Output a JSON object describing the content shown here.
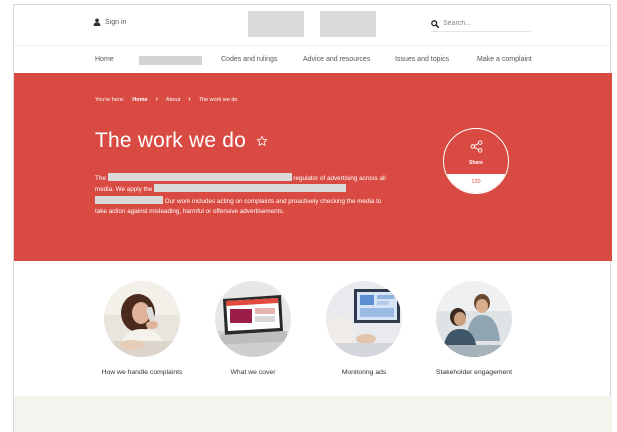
{
  "header": {
    "sign_in_label": "Sign in",
    "search_placeholder": "Search..."
  },
  "nav": {
    "items": [
      "Home",
      "Codes and rulings",
      "Advice and resources",
      "Issues and topics",
      "Make a complaint"
    ]
  },
  "hero": {
    "breadcrumb_prefix": "You're here:",
    "breadcrumb": [
      "Home",
      "About",
      "The work we do"
    ],
    "title": "The work we do",
    "text_1": "The",
    "text_2": "regulator of advertising across all media. We apply the",
    "text_3": "Our work includes acting on complaints and proactively checking the media to take action against misleading, harmful or offensive advertisements.",
    "share_label": "Share",
    "share_count": "120"
  },
  "cards": [
    {
      "label": "How we handle complaints",
      "icon": "woman-on-phone-photo"
    },
    {
      "label": "What we cover",
      "icon": "laptop-website-photo"
    },
    {
      "label": "Monitoring ads",
      "icon": "monitor-analytics-photo"
    },
    {
      "label": "Stakeholder engagement",
      "icon": "meeting-photo"
    }
  ],
  "colors": {
    "hero_bg": "#d94b42",
    "bottom_band": "#f4f4ee"
  }
}
